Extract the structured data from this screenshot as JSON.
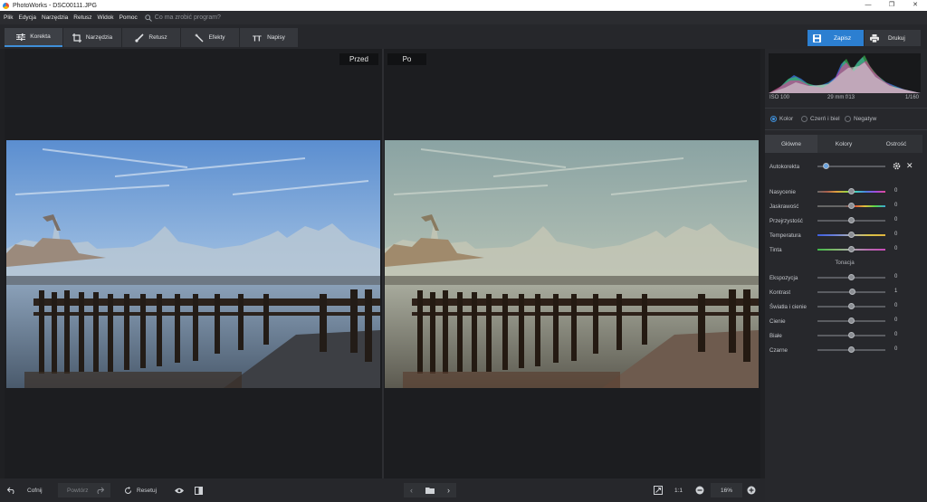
{
  "window": {
    "title": "PhotoWorks - DSC00111.JPG"
  },
  "menu": {
    "items": [
      "Plik",
      "Edycja",
      "Narzędzia",
      "Retusz",
      "Widok",
      "Pomoc"
    ],
    "search_placeholder": "Co ma zrobić program?"
  },
  "tabs": [
    {
      "label": "Korekta",
      "icon": "sliders-icon"
    },
    {
      "label": "Narzędzia",
      "icon": "crop-icon"
    },
    {
      "label": "Retusz",
      "icon": "brush-icon"
    },
    {
      "label": "Efekty",
      "icon": "magic-wand-icon"
    },
    {
      "label": "Napisy",
      "icon": "text-icon"
    }
  ],
  "actions": {
    "save": "Zapisz",
    "print": "Drukuj"
  },
  "compare": {
    "before": "Przed",
    "after": "Po"
  },
  "bottom": {
    "undo": "Cofnij",
    "redo": "Powtórz",
    "reset": "Resetuj",
    "ratio": "1:1",
    "zoom": "16%"
  },
  "histogram": {
    "iso": "ISO 100",
    "lens": "29 mm f/13",
    "shutter": "1/160"
  },
  "color_mode": {
    "options": [
      "Kolor",
      "Czerń i biel",
      "Negatyw"
    ],
    "selected": "Kolor"
  },
  "panel_tabs": [
    "Główne",
    "Kolory",
    "Ostrość"
  ],
  "autokorekta": "Autokorekta",
  "sliders": [
    {
      "name": "Nasycenie",
      "value": "0",
      "pos": 0.5,
      "gradient": "linear-gradient(90deg,#666,#aa5f4d,#e0a13d,#9ccf43,#43cfc0,#4b7fe0,#a04be0,#e04b9a)"
    },
    {
      "name": "Jaskrawość",
      "value": "0",
      "pos": 0.5,
      "gradient": "linear-gradient(90deg,#666,#666 40%,#d8563a,#e0c13d,#56d84a,#3aa6d8)"
    },
    {
      "name": "Przejrzystość",
      "value": "0",
      "pos": 0.5,
      "gradient": "#5a5c61"
    },
    {
      "name": "Temperatura",
      "value": "0",
      "pos": 0.5,
      "gradient": "linear-gradient(90deg,#3d5fe0,#6a7fd8,#aab0b8,#d8c24a,#e0b43d)"
    },
    {
      "name": "Tinta",
      "value": "0",
      "pos": 0.5,
      "gradient": "linear-gradient(90deg,#3fb84a,#7fb86a,#aaa,#b86ab0,#c84ab8)"
    }
  ],
  "tonacja": "Tonacja",
  "tone_sliders": [
    {
      "name": "Ekspozycja",
      "value": "0",
      "pos": 0.5
    },
    {
      "name": "Kontrast",
      "value": "1",
      "pos": 0.51
    },
    {
      "name": "Światła i cienie",
      "value": "0",
      "pos": 0.5
    },
    {
      "name": "Cienie",
      "value": "0",
      "pos": 0.5
    },
    {
      "name": "Białe",
      "value": "0",
      "pos": 0.5
    },
    {
      "name": "Czarne",
      "value": "0",
      "pos": 0.5
    }
  ],
  "autokorekta_pos": 0.13
}
